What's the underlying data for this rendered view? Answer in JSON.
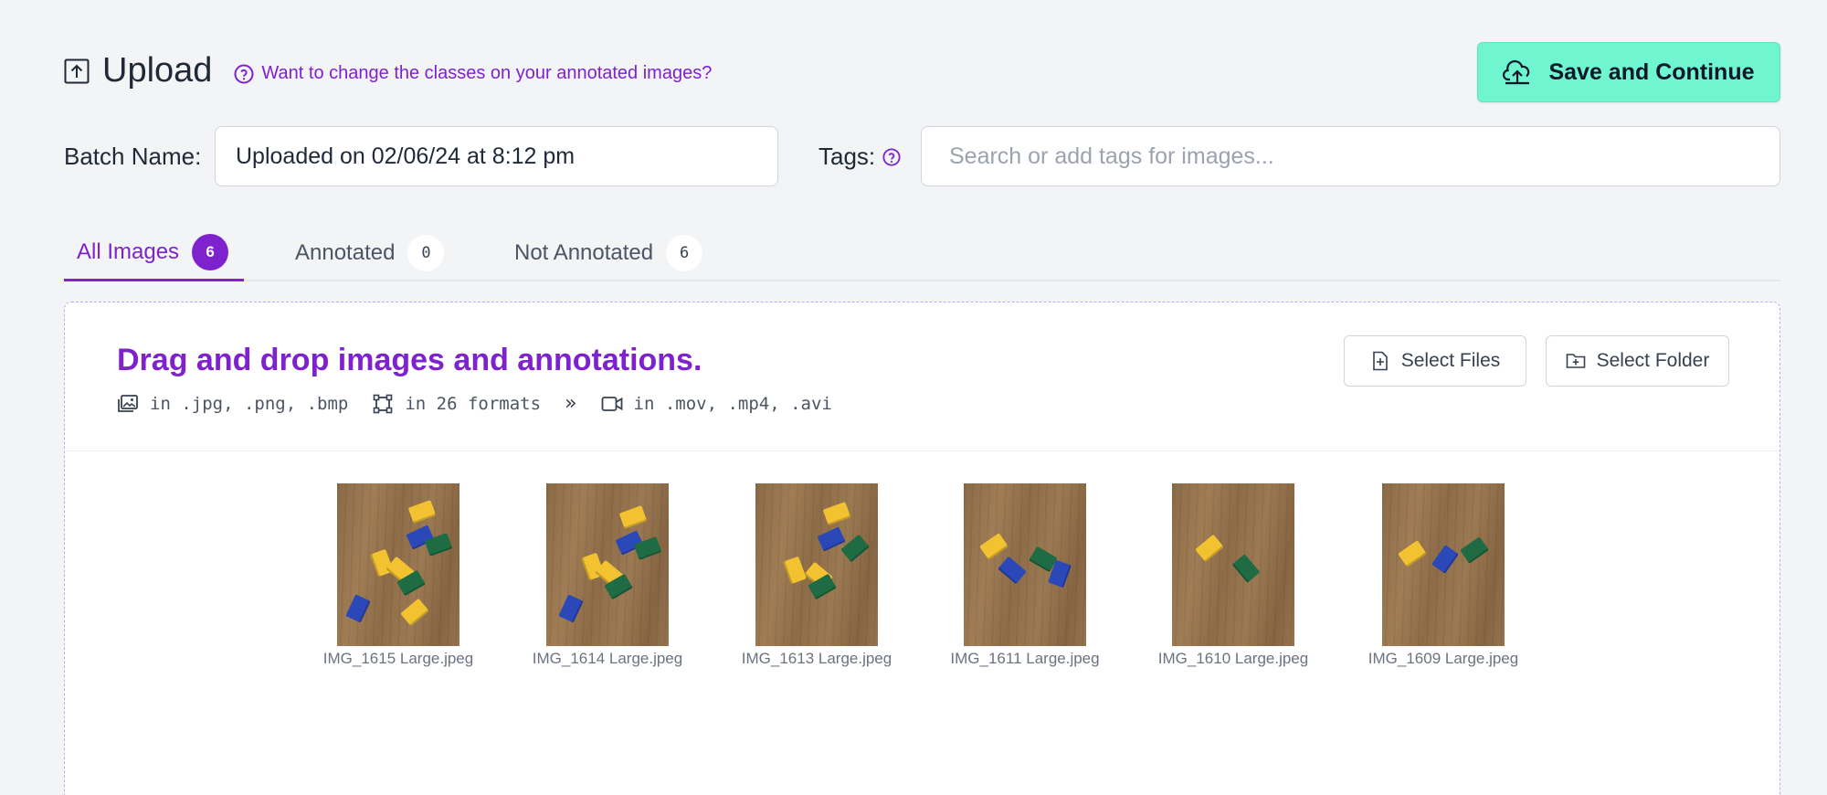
{
  "header": {
    "title": "Upload",
    "help_link": "Want to change the classes on your annotated images?",
    "save_button": "Save and Continue"
  },
  "batch": {
    "label": "Batch Name:",
    "value": "Uploaded on 02/06/24 at 8:12 pm"
  },
  "tags": {
    "label": "Tags:",
    "placeholder": "Search or add tags for images..."
  },
  "tabs": [
    {
      "label": "All Images",
      "count": "6",
      "active": true
    },
    {
      "label": "Annotated",
      "count": "0",
      "active": false
    },
    {
      "label": "Not Annotated",
      "count": "6",
      "active": false
    }
  ],
  "dropzone": {
    "title": "Drag and drop images and annotations.",
    "image_formats": "in .jpg, .png, .bmp",
    "annotation_formats": "in 26 formats",
    "more": "»",
    "video_formats": "in .mov, .mp4, .avi",
    "select_files": "Select Files",
    "select_folder": "Select Folder"
  },
  "images": [
    {
      "name": "IMG_1615 Large.jpeg"
    },
    {
      "name": "IMG_1614 Large.jpeg"
    },
    {
      "name": "IMG_1613 Large.jpeg"
    },
    {
      "name": "IMG_1611 Large.jpeg"
    },
    {
      "name": "IMG_1610 Large.jpeg"
    },
    {
      "name": "IMG_1609 Large.jpeg"
    }
  ],
  "colors": {
    "accent": "#7e22ce",
    "save_button": "#6ff5cf"
  }
}
